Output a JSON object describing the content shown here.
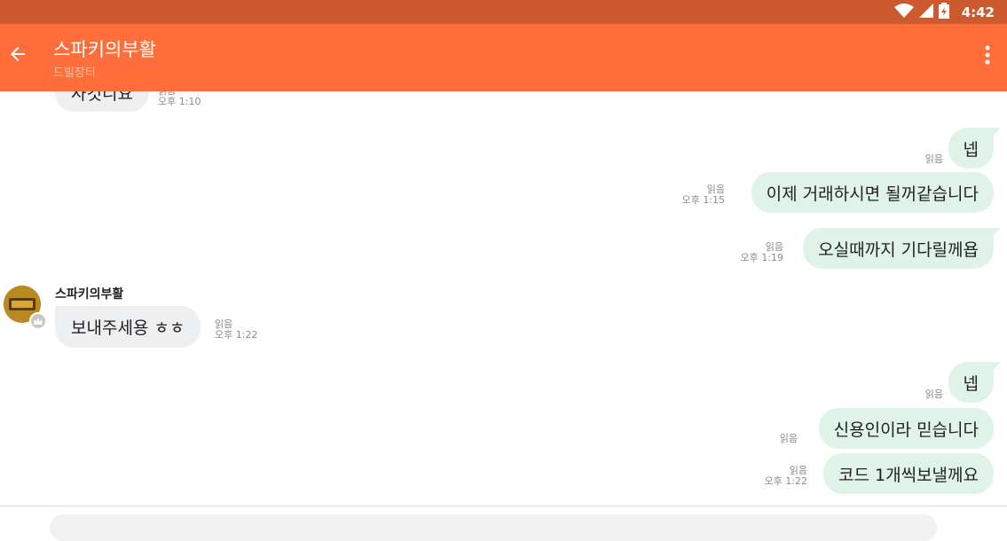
{
  "status_bar": {
    "time": "4:42",
    "icons": [
      "wifi-icon",
      "signal-icon",
      "battery-icon"
    ]
  },
  "header": {
    "title": "스파키의부활",
    "subtitle": "드빌장터",
    "back_icon": "arrow-left-icon",
    "menu_icon": "more-vertical-icon"
  },
  "messages": [
    {
      "direction": "in",
      "text": "사것니요",
      "read": "읽음",
      "time": "오후 1:10"
    },
    {
      "direction": "out",
      "text": "넵",
      "read": "읽음",
      "time": ""
    },
    {
      "direction": "out",
      "text": "이제 거래하시면 될꺼같습니다",
      "read": "읽음",
      "time": "오후 1:15"
    },
    {
      "direction": "out",
      "text": "오실때까지 기다릴께욥",
      "read": "읽음",
      "time": "오후 1:19"
    },
    {
      "direction": "in",
      "sender": "스파키의부활",
      "text": "보내주세용 ㅎㅎ",
      "read": "읽음",
      "time": "오후 1:22"
    },
    {
      "direction": "out",
      "text": "넵",
      "read": "읽음",
      "time": ""
    },
    {
      "direction": "out",
      "text": "신용인이라 믿습니다",
      "read": "읽음",
      "time": ""
    },
    {
      "direction": "out",
      "text": "코드 1개씩보낼께요",
      "read": "읽음",
      "time": "오후 1:22"
    }
  ],
  "colors": {
    "status_bar": "#cc5a2e",
    "app_bar": "#ff6e3a",
    "incoming_bubble": "#eeeff1",
    "outgoing_bubble": "#e0f3e8"
  }
}
